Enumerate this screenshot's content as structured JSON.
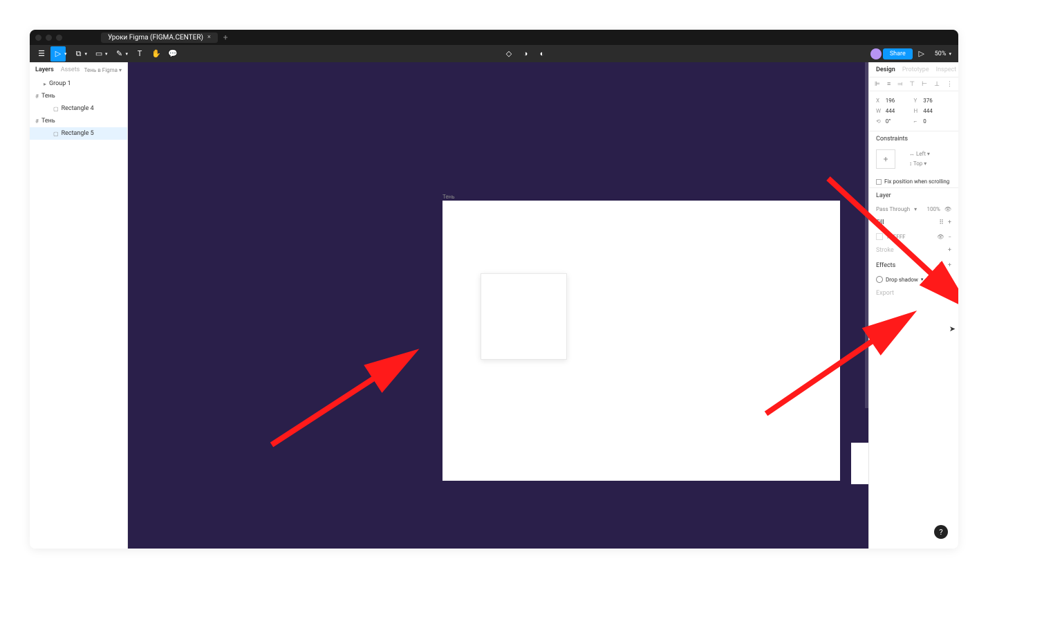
{
  "titlebar": {
    "tab_title": "Уроки Figma (FIGMA.CENTER)",
    "close": "×",
    "new_tab": "+"
  },
  "toolbar": {
    "share": "Share",
    "zoom": "50%"
  },
  "left_panel": {
    "tabs": {
      "layers": "Layers",
      "assets": "Assets"
    },
    "page": "Тень в Figma",
    "layers": [
      "Group 1",
      "Тень",
      "Rectangle 4",
      "Тень",
      "Rectangle 5"
    ]
  },
  "canvas": {
    "frame_label": "Тень"
  },
  "right_panel": {
    "tabs": {
      "design": "Design",
      "prototype": "Prototype",
      "inspect": "Inspect"
    },
    "position": {
      "x_label": "X",
      "x": "196",
      "y_label": "Y",
      "y": "376",
      "w_label": "W",
      "w": "444",
      "h_label": "H",
      "h": "444",
      "rot_label": "",
      "rotation": "0°",
      "corner": "0"
    },
    "constraints": {
      "title": "Constraints",
      "h": "Left",
      "v": "Top",
      "fix": "Fix position when scrolling"
    },
    "layer": {
      "title": "Layer",
      "blend": "Pass Through",
      "opacity": "100%"
    },
    "fill": {
      "title": "Fill",
      "hex": "FFFFFF"
    },
    "stroke": {
      "title": "Stroke"
    },
    "effects": {
      "title": "Effects",
      "item": "Drop shadow"
    },
    "export": {
      "title": "Export"
    }
  },
  "help": "?"
}
